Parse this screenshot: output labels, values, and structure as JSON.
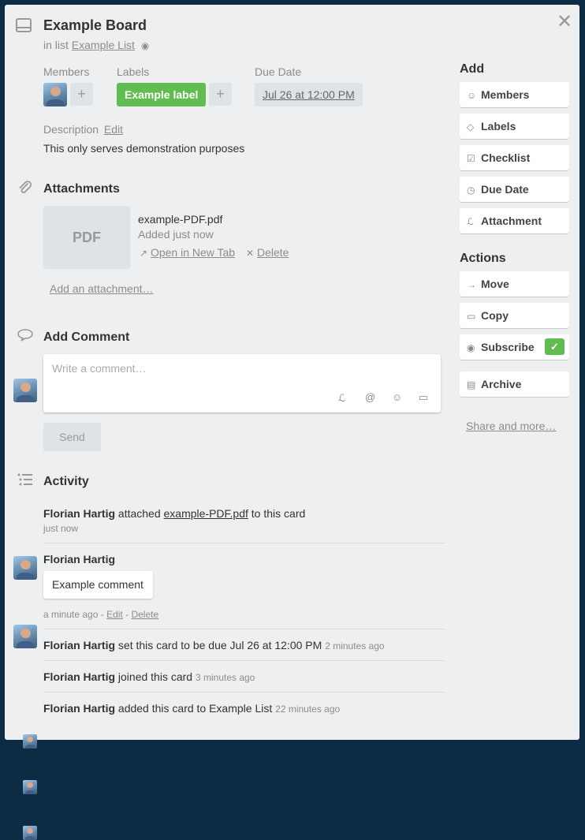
{
  "card": {
    "title": "Example Board",
    "in_list_prefix": "in list",
    "list_name": "Example List"
  },
  "labels": {
    "members": "Members",
    "labels": "Labels",
    "due_date": "Due Date",
    "label_name": "Example label",
    "label_color": "#61bd4f",
    "due_value": "Jul 26 at 12:00 PM",
    "plus": "+"
  },
  "description": {
    "heading": "Description",
    "edit": "Edit",
    "text": "This only serves demonstration purposes"
  },
  "attachments": {
    "heading": "Attachments",
    "thumb_text": "PDF",
    "file_name": "example-PDF.pdf",
    "added": "Added just now",
    "open": "Open in New Tab",
    "delete": "Delete",
    "add": "Add an attachment…"
  },
  "comment": {
    "heading": "Add Comment",
    "placeholder": "Write a comment…",
    "send": "Send"
  },
  "activity": {
    "heading": "Activity",
    "items": [
      {
        "user": "Florian Hartig",
        "pre": "attached",
        "link": "example-PDF.pdf",
        "post": "to this card",
        "time": "just now"
      },
      {
        "user": "Florian Hartig",
        "comment": "Example comment",
        "time": "a minute ago",
        "edit": "Edit",
        "delete": "Delete",
        "sep": "-"
      },
      {
        "user": "Florian Hartig",
        "text": "set this card to be due Jul 26 at 12:00 PM",
        "time": "2 minutes ago"
      },
      {
        "user": "Florian Hartig",
        "text": "joined this card",
        "time": "3 minutes ago"
      },
      {
        "user": "Florian Hartig",
        "text": "added this card to Example List",
        "time": "22 minutes ago"
      }
    ]
  },
  "sidebar": {
    "add_heading": "Add",
    "add_items": [
      {
        "label": "Members",
        "icon": "person-icon"
      },
      {
        "label": "Labels",
        "icon": "tag-icon"
      },
      {
        "label": "Checklist",
        "icon": "checkbox-icon"
      },
      {
        "label": "Due Date",
        "icon": "clock-icon"
      },
      {
        "label": "Attachment",
        "icon": "paperclip-icon"
      }
    ],
    "actions_heading": "Actions",
    "action_items": [
      {
        "label": "Move",
        "icon": "arrow-right-icon"
      },
      {
        "label": "Copy",
        "icon": "card-icon"
      },
      {
        "label": "Subscribe",
        "icon": "eye-icon",
        "checked": true
      },
      {
        "label": "Archive",
        "icon": "archive-icon"
      }
    ],
    "share": "Share and more…"
  }
}
